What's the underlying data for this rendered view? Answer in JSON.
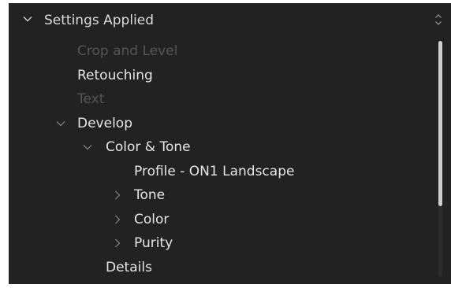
{
  "header": {
    "title": "Settings Applied",
    "expand_icon": "chevron-down-icon",
    "sort_icon": "sort-up-down-icon"
  },
  "tree": [
    {
      "label": "Crop and Level",
      "state": "disabled"
    },
    {
      "label": "Retouching",
      "state": "enabled"
    },
    {
      "label": "Text",
      "state": "disabled"
    },
    {
      "label": "Develop",
      "state": "enabled",
      "expanded": true
    },
    {
      "label": "Color & Tone",
      "state": "enabled",
      "expanded": true
    },
    {
      "label": "Profile - ON1 Landscape",
      "state": "enabled"
    },
    {
      "label": "Tone",
      "state": "enabled",
      "expanded": false
    },
    {
      "label": "Color",
      "state": "enabled",
      "expanded": false
    },
    {
      "label": "Purity",
      "state": "enabled",
      "expanded": false
    },
    {
      "label": "Details",
      "state": "enabled"
    }
  ],
  "colors": {
    "panel_background": "#222222",
    "text_enabled": "#e6e6e6",
    "text_disabled": "#6a6a6a",
    "chevron": "#8a8a8a",
    "scrollbar_thumb": "#cfcfcf"
  }
}
